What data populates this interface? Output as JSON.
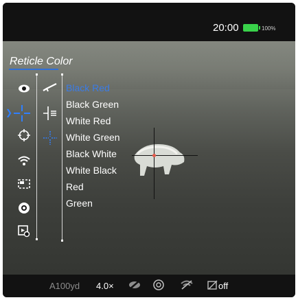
{
  "status": {
    "time": "20:00",
    "battery_percent": "100%",
    "battery_color": "#39d24a"
  },
  "menu": {
    "title": "Reticle Color",
    "accent_color": "#2f6fd8",
    "side_icons": [
      {
        "name": "eye-icon"
      },
      {
        "name": "reticle-crosshair-icon",
        "selected": true
      },
      {
        "name": "target-icon"
      },
      {
        "name": "wifi-icon"
      },
      {
        "name": "pip-icon"
      },
      {
        "name": "aperture-icon"
      },
      {
        "name": "video-settings-icon"
      }
    ],
    "sub_icons": [
      {
        "name": "rifle-icon"
      },
      {
        "name": "reticle-type-icon"
      },
      {
        "name": "reticle-color-icon",
        "selected": true
      }
    ],
    "options": [
      {
        "label": "Black Red",
        "active": true
      },
      {
        "label": "Black Green"
      },
      {
        "label": "White Red"
      },
      {
        "label": "White Green"
      },
      {
        "label": "Black White"
      },
      {
        "label": "White Black"
      },
      {
        "label": "Red"
      },
      {
        "label": "Green"
      }
    ]
  },
  "footer": {
    "distance": "A100yd",
    "zoom": "4.0×",
    "state": "off"
  }
}
